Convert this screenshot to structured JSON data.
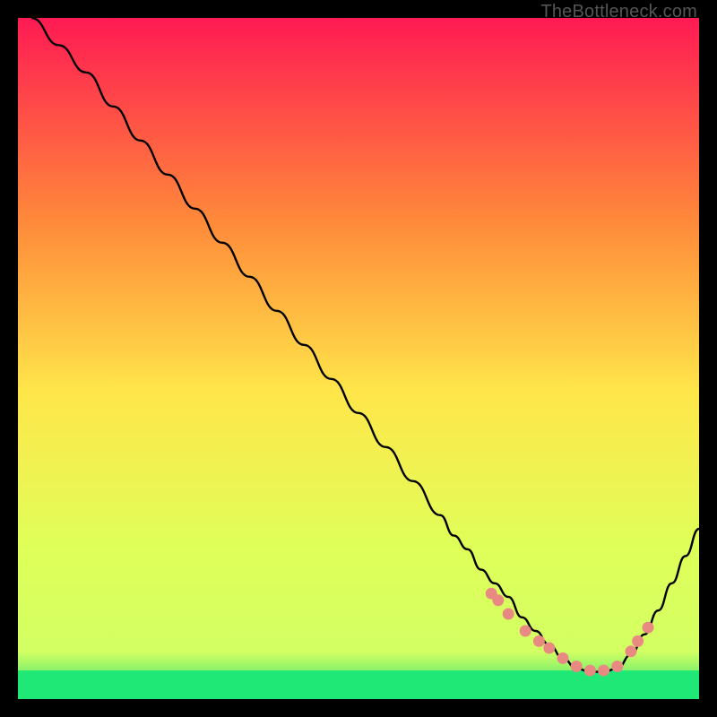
{
  "watermark": "TheBottleneck.com",
  "chart_data": {
    "type": "line",
    "title": "",
    "xlabel": "",
    "ylabel": "",
    "xlim": [
      0,
      100
    ],
    "ylim": [
      0,
      100
    ],
    "background_gradient": {
      "top": "#ff1a53",
      "mid1": "#ff8a3a",
      "mid2": "#ffe64a",
      "mid3": "#dfff59",
      "bottom": "#1fe073"
    },
    "series": [
      {
        "name": "bottleneck-curve",
        "color": "#000000",
        "x": [
          2,
          6,
          10,
          14,
          18,
          22,
          26,
          30,
          34,
          38,
          42,
          46,
          50,
          54,
          58,
          62,
          64,
          66,
          68,
          70,
          72,
          74,
          76,
          78,
          80,
          82,
          84,
          86,
          88,
          90,
          92,
          94,
          96,
          98,
          100
        ],
        "y": [
          100,
          96,
          92,
          87,
          82,
          77,
          72,
          67,
          62,
          57,
          52,
          47,
          42,
          37,
          32,
          27,
          24,
          22,
          19,
          17,
          15,
          12,
          10,
          8,
          6,
          4.5,
          4,
          4,
          4.5,
          6.5,
          9.5,
          13,
          17,
          21,
          25
        ]
      }
    ],
    "points": {
      "name": "highlight-points",
      "color": "#e88a82",
      "x": [
        69.5,
        70.5,
        72,
        74.5,
        76.5,
        78,
        80,
        82,
        84,
        86,
        88,
        90,
        91,
        92.5
      ],
      "y": [
        15.5,
        14.5,
        12.5,
        10,
        8.5,
        7.5,
        6,
        4.8,
        4.2,
        4.2,
        4.8,
        7,
        8.5,
        10.5
      ]
    },
    "green_band_top_y": 4.2
  }
}
